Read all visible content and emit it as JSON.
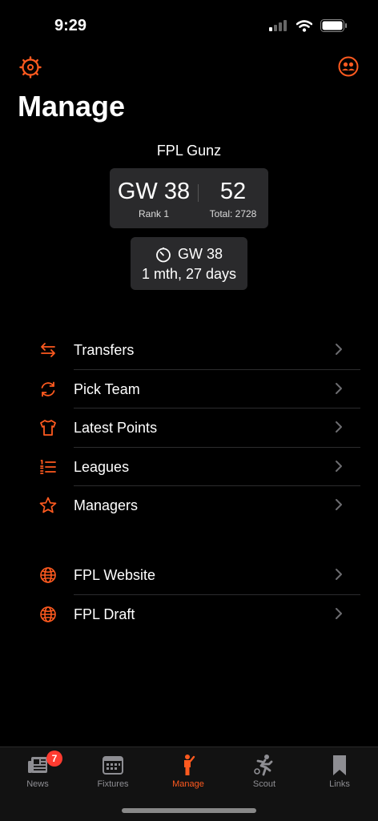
{
  "status_bar": {
    "time": "9:29"
  },
  "header": {
    "title": "Manage"
  },
  "team": {
    "name": "FPL Gunz",
    "gameweek": "GW 38",
    "rank_label": "Rank 1",
    "points": "52",
    "total_label": "Total: 2728"
  },
  "deadline": {
    "gameweek": "GW 38",
    "countdown": "1 mth, 27 days"
  },
  "menu_main": [
    {
      "label": "Transfers",
      "icon": "transfer-arrows-icon"
    },
    {
      "label": "Pick Team",
      "icon": "refresh-icon"
    },
    {
      "label": "Latest Points",
      "icon": "shirt-icon"
    },
    {
      "label": "Leagues",
      "icon": "numbered-list-icon"
    },
    {
      "label": "Managers",
      "icon": "star-icon"
    }
  ],
  "menu_links": [
    {
      "label": "FPL Website",
      "icon": "globe-icon"
    },
    {
      "label": "FPL Draft",
      "icon": "globe-icon"
    }
  ],
  "tabs": [
    {
      "label": "News",
      "icon": "newspaper-icon",
      "badge": "7"
    },
    {
      "label": "Fixtures",
      "icon": "calendar-icon"
    },
    {
      "label": "Manage",
      "icon": "person-icon",
      "active": true
    },
    {
      "label": "Scout",
      "icon": "runner-icon"
    },
    {
      "label": "Links",
      "icon": "bookmark-icon"
    }
  ],
  "colors": {
    "accent": "#ff5a1f",
    "card": "#2a2a2c",
    "background": "#000000",
    "badge": "#ff3b30"
  }
}
